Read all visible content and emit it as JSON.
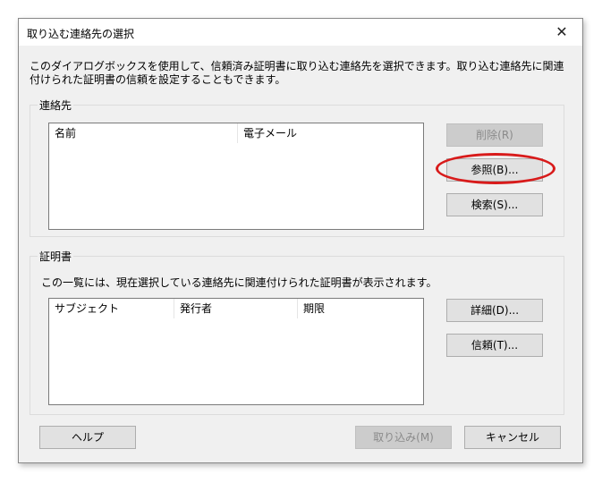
{
  "dialog": {
    "title": "取り込む連絡先の選択",
    "close_glyph": "✕",
    "description": "このダイアログボックスを使用して、信頼済み証明書に取り込む連絡先を選択できます。取り込む連絡先に関連付けられた証明書の信頼を設定することもできます。"
  },
  "contacts": {
    "group_label": "連絡先",
    "columns": [
      "名前",
      "電子メール"
    ],
    "buttons": {
      "delete": "削除(R)",
      "browse": "参照(B)...",
      "search": "検索(S)..."
    }
  },
  "certificates": {
    "group_label": "証明書",
    "note": "この一覧には、現在選択している連絡先に関連付けられた証明書が表示されます。",
    "columns": [
      "サブジェクト",
      "発行者",
      "期限"
    ],
    "buttons": {
      "details": "詳細(D)...",
      "trust": "信頼(T)..."
    }
  },
  "footer": {
    "help": "ヘルプ",
    "import": "取り込み(M)",
    "cancel": "キャンセル"
  },
  "colors": {
    "highlight": "#d81b1b",
    "dialog_bg": "#f0f0f0",
    "button_bg": "#e1e1e1"
  }
}
